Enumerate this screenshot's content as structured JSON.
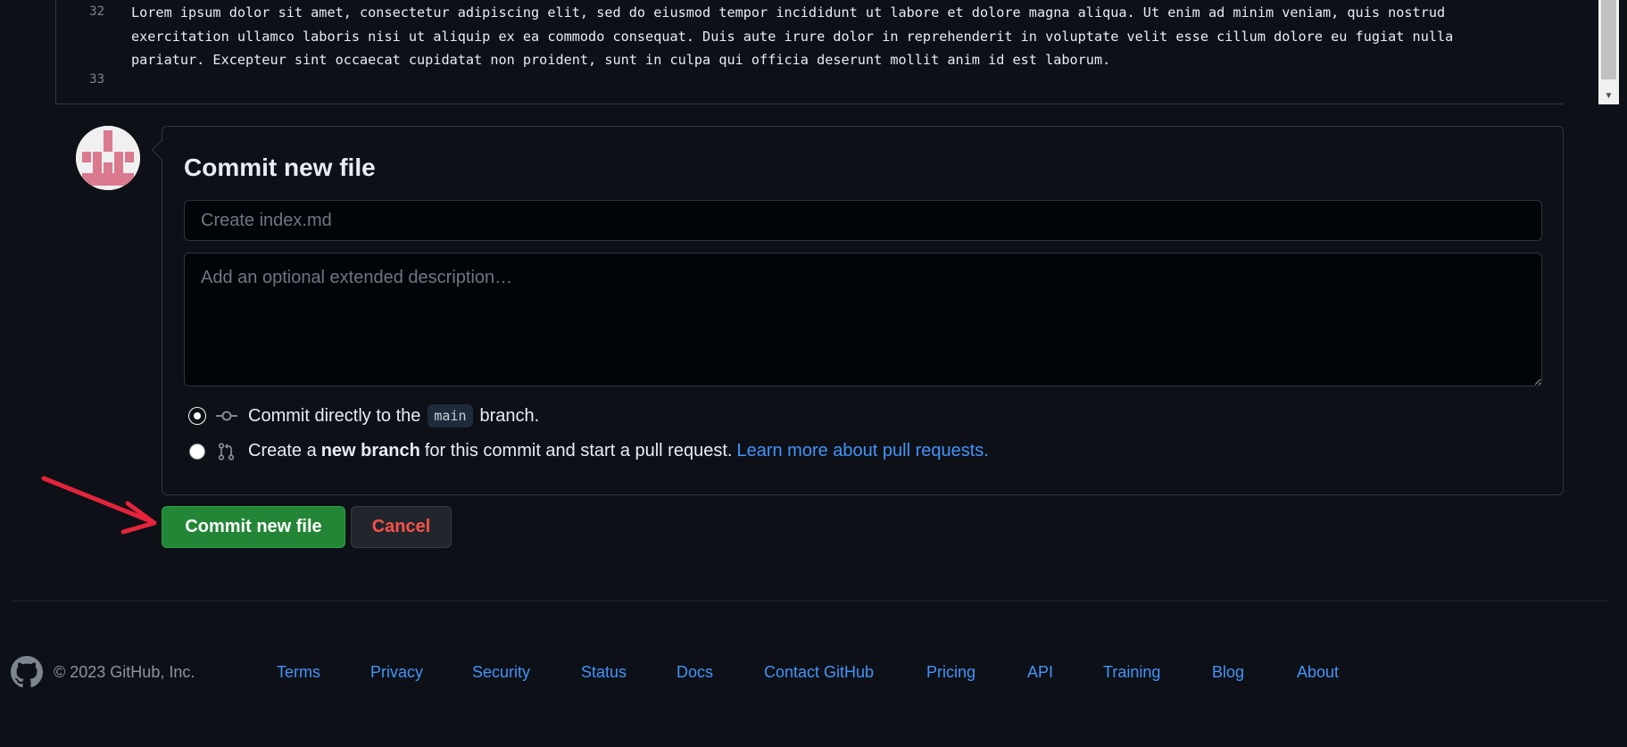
{
  "editor": {
    "lines": [
      {
        "number": "32",
        "text": "Lorem ipsum dolor sit amet, consectetur adipiscing elit, sed do eiusmod tempor incididunt ut labore et dolore magna aliqua. Ut enim ad minim veniam, quis nostrud exercitation ullamco laboris nisi ut aliquip ex ea commodo consequat. Duis aute irure dolor in reprehenderit in voluptate velit esse cillum dolore eu fugiat nulla pariatur. Excepteur sint occaecat cupidatat non proident, sunt in culpa qui officia deserunt mollit anim id est laborum."
      },
      {
        "number": "33",
        "text": ""
      }
    ]
  },
  "commit": {
    "title": "Commit new file",
    "summary_placeholder": "Create index.md",
    "description_placeholder": "Add an optional extended description…",
    "option_direct": {
      "prefix": "Commit directly to the",
      "branch": "main",
      "suffix": "branch.",
      "selected": true
    },
    "option_new_branch": {
      "prefix": "Create a",
      "bold": "new branch",
      "suffix": "for this commit and start a pull request.",
      "link": "Learn more about pull requests.",
      "selected": false
    },
    "commit_button": "Commit new file",
    "cancel_button": "Cancel"
  },
  "footer": {
    "copyright": "© 2023 GitHub, Inc.",
    "links": [
      "Terms",
      "Privacy",
      "Security",
      "Status",
      "Docs",
      "Contact GitHub",
      "Pricing",
      "API",
      "Training",
      "Blog",
      "About"
    ]
  },
  "colors": {
    "background": "#0d1117",
    "accent_link": "#4493f8",
    "commit_green": "#238636",
    "cancel_red": "#f85149",
    "annotation_arrow": "#e5243b",
    "avatar_pink": "#d97a8e"
  },
  "icons": [
    "github-logo-icon",
    "git-commit-icon",
    "git-pull-request-icon",
    "avatar-identicon"
  ]
}
